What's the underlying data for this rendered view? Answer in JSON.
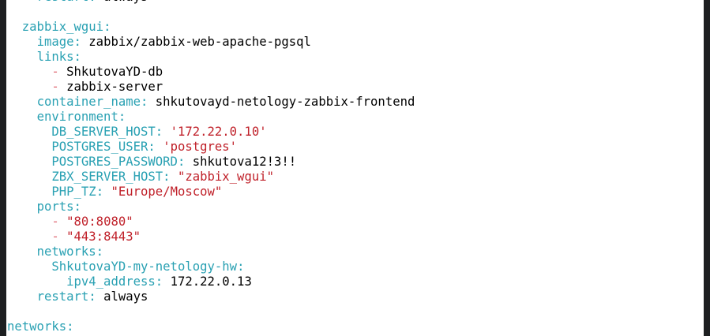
{
  "lines": [
    {
      "indent": "    ",
      "key": "restart",
      "value": "always",
      "vtype": "plain"
    },
    {
      "indent": "",
      "key": "",
      "value": "",
      "vtype": "blank"
    },
    {
      "indent": "  ",
      "key": "zabbix_wgui",
      "value": "",
      "vtype": "none"
    },
    {
      "indent": "    ",
      "key": "image",
      "value": "zabbix/zabbix-web-apache-pgsql",
      "vtype": "plain"
    },
    {
      "indent": "    ",
      "key": "links",
      "value": "",
      "vtype": "none"
    },
    {
      "indent": "      ",
      "dash": "-",
      "value": "ShkutovaYD-db",
      "vtype": "list-plain"
    },
    {
      "indent": "      ",
      "dash": "-",
      "value": "zabbix-server",
      "vtype": "list-plain"
    },
    {
      "indent": "    ",
      "key": "container_name",
      "value": "shkutovayd-netology-zabbix-frontend",
      "vtype": "plain"
    },
    {
      "indent": "    ",
      "key": "environment",
      "value": "",
      "vtype": "none"
    },
    {
      "indent": "      ",
      "key": "DB_SERVER_HOST",
      "value": "'172.22.0.10'",
      "vtype": "string"
    },
    {
      "indent": "      ",
      "key": "POSTGRES_USER",
      "value": "'postgres'",
      "vtype": "string"
    },
    {
      "indent": "      ",
      "key": "POSTGRES_PASSWORD",
      "value": "shkutova12!3!!",
      "vtype": "plain"
    },
    {
      "indent": "      ",
      "key": "ZBX_SERVER_HOST",
      "value": "\"zabbix_wgui\"",
      "vtype": "string"
    },
    {
      "indent": "      ",
      "key": "PHP_TZ",
      "value": "\"Europe/Moscow\"",
      "vtype": "string"
    },
    {
      "indent": "    ",
      "key": "ports",
      "value": "",
      "vtype": "none"
    },
    {
      "indent": "      ",
      "dash": "-",
      "value": "\"80:8080\"",
      "vtype": "list-string"
    },
    {
      "indent": "      ",
      "dash": "-",
      "value": "\"443:8443\"",
      "vtype": "list-string"
    },
    {
      "indent": "    ",
      "key": "networks",
      "value": "",
      "vtype": "none"
    },
    {
      "indent": "      ",
      "key": "ShkutovaYD-my-netology-hw",
      "value": "",
      "vtype": "none"
    },
    {
      "indent": "        ",
      "key": "ipv4_address",
      "value": "172.22.0.13",
      "vtype": "plain"
    },
    {
      "indent": "    ",
      "key": "restart",
      "value": "always",
      "vtype": "plain"
    },
    {
      "indent": "",
      "key": "",
      "value": "",
      "vtype": "blank"
    },
    {
      "indent": "",
      "key": "networks",
      "value": "",
      "vtype": "none"
    }
  ]
}
